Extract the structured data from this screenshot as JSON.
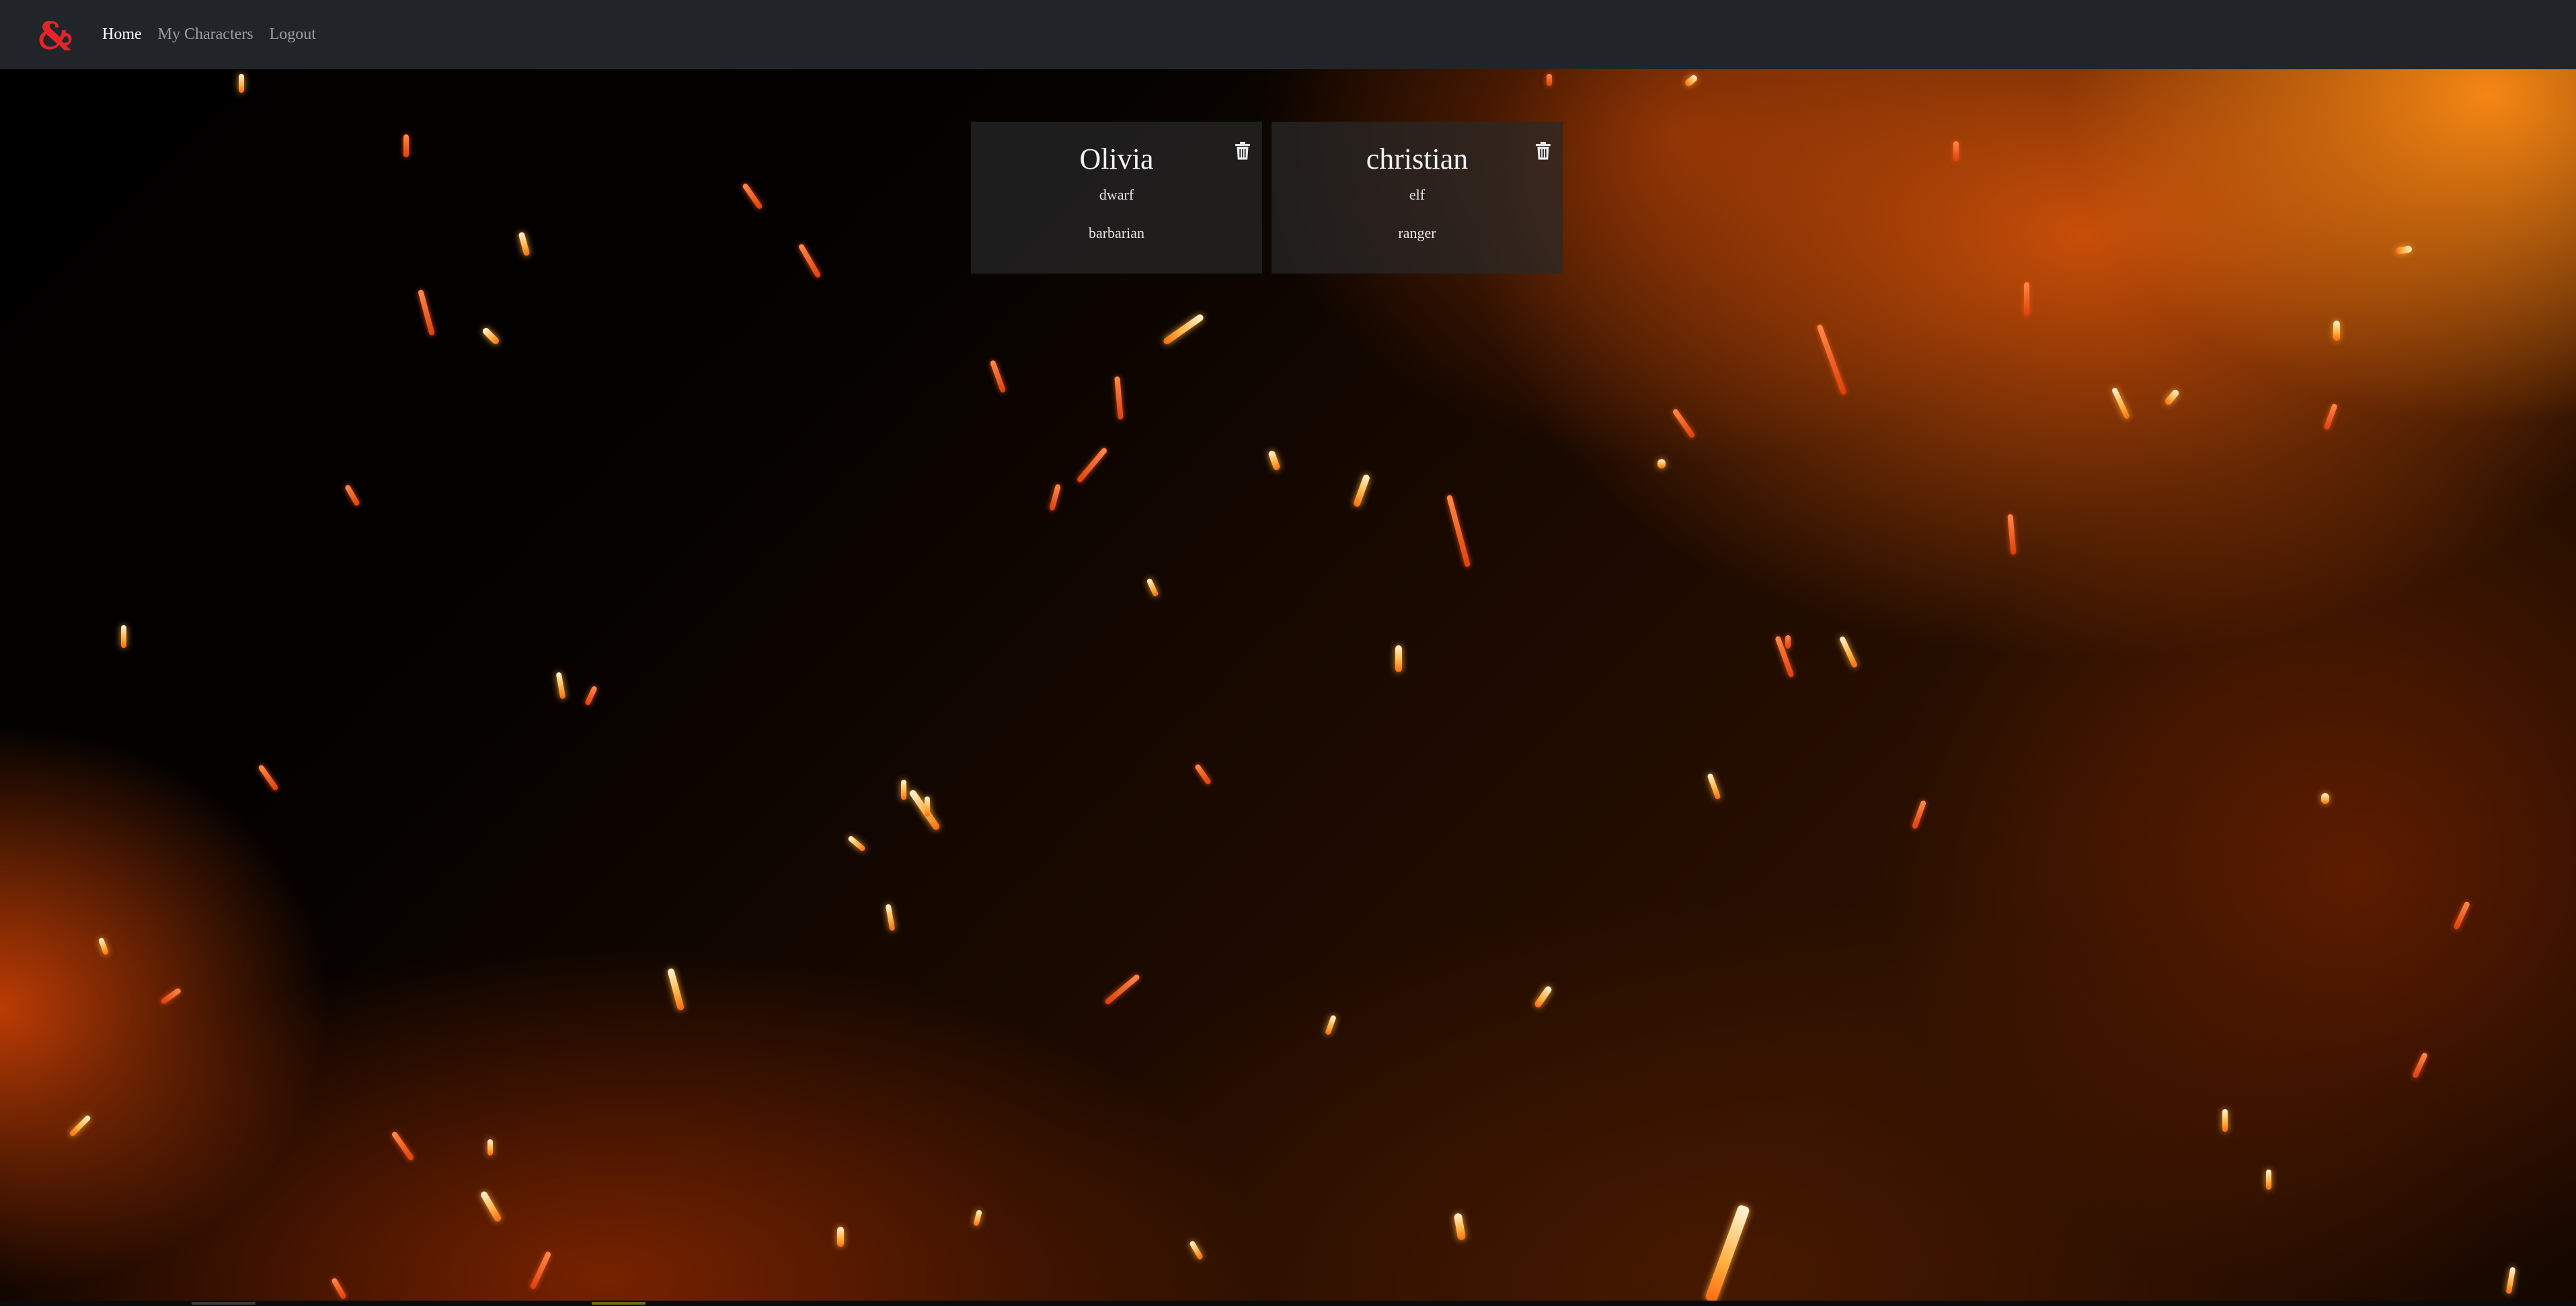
{
  "navbar": {
    "logo_icon": "dnd-ampersand-logo-icon",
    "links": [
      {
        "label": "Home",
        "active": true
      },
      {
        "label": "My Characters",
        "active": false
      },
      {
        "label": "Logout",
        "active": false
      }
    ]
  },
  "characters": [
    {
      "name": "Olivia",
      "race": "dwarf",
      "class": "barbarian",
      "delete_icon": "trash-icon"
    },
    {
      "name": "christian",
      "race": "elf",
      "class": "ranger",
      "delete_icon": "trash-icon"
    }
  ],
  "colors": {
    "navbar_bg": "#212529",
    "logo_red": "#e0252b",
    "card_bg": "rgba(40,40,40,0.72)"
  }
}
